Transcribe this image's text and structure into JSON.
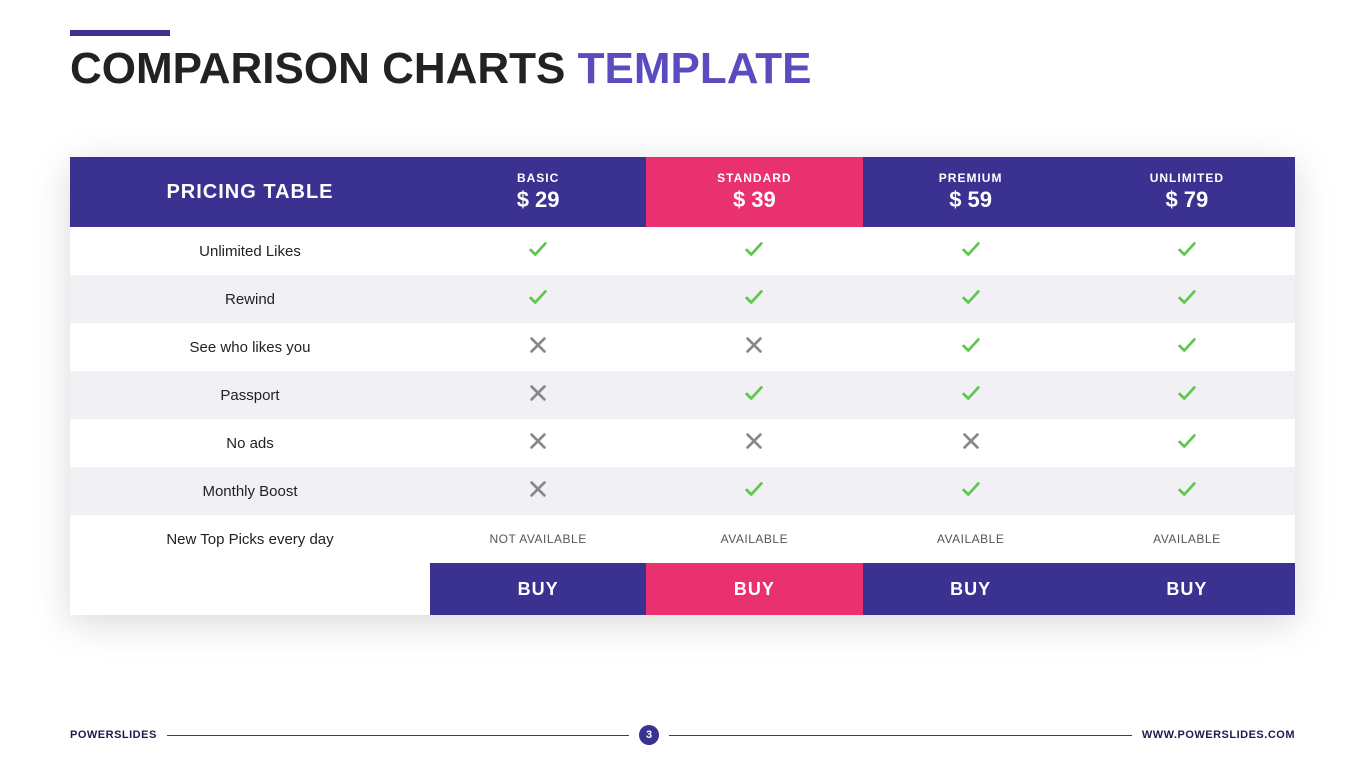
{
  "title": {
    "part1": "COMPARISON CHARTS ",
    "part2": "TEMPLATE"
  },
  "header_label": "PRICING TABLE",
  "plans": [
    {
      "name": "BASIC",
      "price": "$ 29",
      "buy": "BUY",
      "featured": false
    },
    {
      "name": "STANDARD",
      "price": "$ 39",
      "buy": "BUY",
      "featured": true
    },
    {
      "name": "PREMIUM",
      "price": "$ 59",
      "buy": "BUY",
      "featured": false
    },
    {
      "name": "UNLIMITED",
      "price": "$ 79",
      "buy": "BUY",
      "featured": false
    }
  ],
  "features": [
    {
      "label": "Unlimited Likes",
      "vals": [
        "check",
        "check",
        "check",
        "check"
      ]
    },
    {
      "label": "Rewind",
      "vals": [
        "check",
        "check",
        "check",
        "check"
      ]
    },
    {
      "label": "See who likes you",
      "vals": [
        "cross",
        "cross",
        "check",
        "check"
      ]
    },
    {
      "label": "Passport",
      "vals": [
        "cross",
        "check",
        "check",
        "check"
      ]
    },
    {
      "label": "No ads",
      "vals": [
        "cross",
        "cross",
        "cross",
        "check"
      ]
    },
    {
      "label": "Monthly Boost",
      "vals": [
        "cross",
        "check",
        "check",
        "check"
      ]
    },
    {
      "label": "New Top Picks every day",
      "vals": [
        "NOT AVAILABLE",
        "AVAILABLE",
        "AVAILABLE",
        "AVAILABLE"
      ],
      "text": true
    }
  ],
  "footer": {
    "brand1": "POWER",
    "brand2": "SLIDES",
    "page": "3",
    "url": "WWW.POWERSLIDES.COM"
  },
  "chart_data": {
    "type": "table",
    "title": "Pricing Table",
    "columns": [
      "Feature",
      "Basic $29",
      "Standard $39",
      "Premium $59",
      "Unlimited $79"
    ],
    "rows": [
      [
        "Unlimited Likes",
        true,
        true,
        true,
        true
      ],
      [
        "Rewind",
        true,
        true,
        true,
        true
      ],
      [
        "See who likes you",
        false,
        false,
        true,
        true
      ],
      [
        "Passport",
        false,
        true,
        true,
        true
      ],
      [
        "No ads",
        false,
        false,
        false,
        true
      ],
      [
        "Monthly Boost",
        false,
        true,
        true,
        true
      ],
      [
        "New Top Picks every day",
        "NOT AVAILABLE",
        "AVAILABLE",
        "AVAILABLE",
        "AVAILABLE"
      ]
    ]
  }
}
